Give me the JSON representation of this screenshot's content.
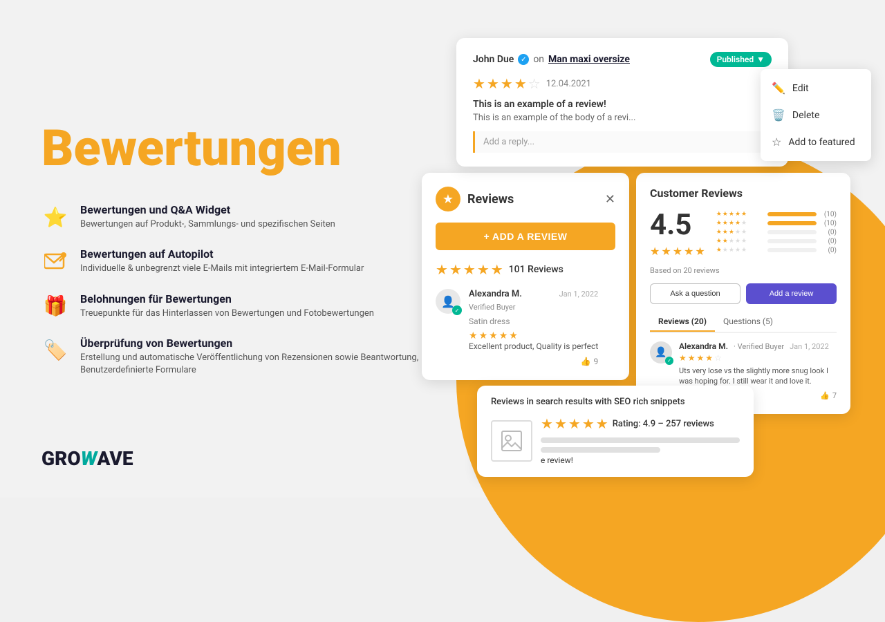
{
  "page": {
    "title": "Bewertungen",
    "background_color": "#f2f2f2",
    "accent_color": "#F5A623"
  },
  "features": [
    {
      "id": "widget",
      "icon": "⭐",
      "title": "Bewertungen und Q&A Widget",
      "description": "Bewertungen auf Produkt-, Sammlungs- und spezifischen Seiten"
    },
    {
      "id": "autopilot",
      "icon": "✉",
      "title": "Bewertungen auf Autopilot",
      "description": "Individuelle & unbegrenzt viele E-Mails mit integriertem E-Mail-Formular"
    },
    {
      "id": "rewards",
      "icon": "🎁",
      "title": "Belohnungen für Bewertungen",
      "description": "Treuepunkte für das Hinterlassen von Bewertungen und Fotobewertungen"
    },
    {
      "id": "verification",
      "icon": "🏷",
      "title": "Überprüfung von Bewertungen",
      "description": "Erstellung und automatische Veröffentlichung von Rezensionen sowie Beantwortung, Benutzerdefinierte Formulare"
    }
  ],
  "logo": {
    "gro": "GRO",
    "w": "W",
    "ave": "AVE"
  },
  "review_card": {
    "reviewer_name": "John Due",
    "on_text": "on",
    "product_link": "Man maxi oversize",
    "published_label": "Published",
    "date": "12.04.2021",
    "stars": 3.5,
    "title": "This is an example of a review!",
    "body": "This is an example of the body of a revi...",
    "reply_placeholder": "Add a reply..."
  },
  "dropdown": {
    "items": [
      {
        "icon": "✏",
        "label": "Edit"
      },
      {
        "icon": "🗑",
        "label": "Delete"
      },
      {
        "icon": "☆",
        "label": "Add to featured"
      }
    ]
  },
  "widget": {
    "title": "Reviews",
    "add_review_btn": "+ ADD A REVIEW",
    "total_reviews": "101 Reviews",
    "reviewer": {
      "name": "Alexandra M.",
      "verified": "Verified Buyer",
      "date": "Jan 1, 2022",
      "product": "Satin dress",
      "review": "Excellent product, Quality is perfect",
      "likes": "9"
    }
  },
  "customer_reviews": {
    "title": "Customer Reviews",
    "average": "4.5",
    "based_on": "Based on 20 reviews",
    "bars": [
      {
        "stars": 5,
        "fill": 100,
        "count": "(10)"
      },
      {
        "stars": 4,
        "fill": 100,
        "count": "(10)"
      },
      {
        "stars": 3,
        "fill": 0,
        "count": "(0)"
      },
      {
        "stars": 2,
        "fill": 0,
        "count": "(0)"
      },
      {
        "stars": 1,
        "fill": 0,
        "count": "(0)"
      }
    ],
    "ask_btn": "Ask a question",
    "add_btn": "Add a review",
    "tabs": [
      {
        "label": "Reviews (20)",
        "active": true
      },
      {
        "label": "Questions (5)",
        "active": false
      }
    ],
    "reviewer": {
      "name": "Alexandra M.",
      "verified": "· Verified Buyer",
      "date": "Jan 1, 2022",
      "stars": 3.5,
      "review": "Uts very lose vs the slightly more snug look I was hoping for. I still wear it and love it.",
      "likes": "7"
    }
  },
  "seo_panel": {
    "title": "Reviews in search results with SEO rich snippets",
    "rating_text": "Rating: 4.9 – 257 reviews",
    "review_preview": "e review!"
  }
}
